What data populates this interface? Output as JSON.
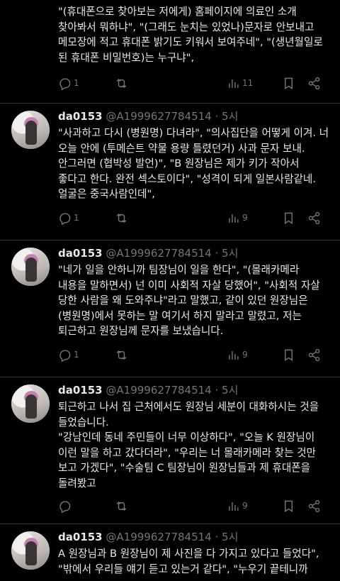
{
  "posts": [
    {
      "text": "\"(휴대폰으로 찾아보는 저에게) 홈페이지에 의료인 소개\n찾아봐서 뭐하냐\", \"(그래도 눈치는 있었나)문자로 안보내고\n메모장에 적고 휴대폰 밝기도 키워서 보여주네\", \"(생년월일로\n된 휴대폰 비밀번호)는 누구냐\",",
      "replies": "1",
      "retweets": "",
      "views": "11"
    },
    {
      "name": "da0153",
      "handle": "@A1999627784514",
      "time": "· 5시",
      "text": "\"사과하고 다시 (병원명) 다녀라\", \"의사집단을 어떻게 이겨. 너\n오늘 안에 (투메슨트 약물 용량 틀렸던거) 사과 문자 보내.\n안그러면 (협박성 발언)\", \"B 원장님은 제가 키가 작아서\n좋다고 한다. 완전 섹스토이다\", \"성격이 되게 일본사람같네.\n얼굴은 중국사람인데\",",
      "replies": "1",
      "retweets": "",
      "views": "9"
    },
    {
      "name": "da0153",
      "handle": "@A1999627784514",
      "time": "· 5시",
      "text": "\"네가 일을 안하니까 팀장님이 일을 한다\", \"(몰래카메라\n내용을 말하면서) 넌 이미 사회적 자살 당했어\", \"사회적 자살\n당한 사람을 왜 도와주냐\"라고 말했고, 같이 있던 원장님은\n(병원명)에서 못하는 말 여기서 하지 말라고 말렸고, 저는\n퇴근하고 원장님께 문자를 보냈습니다.",
      "replies": "1",
      "retweets": "",
      "views": "9"
    },
    {
      "name": "da0153",
      "handle": "@A1999627784514",
      "time": "· 5시",
      "text": "퇴근하고 나서 집 근처에서도 원장님 세분이 대화하시는 것을\n들었습니다.\n\"강남인데 동네 주민들이 너무 이상하다\", \"오늘 K 원장님이\n이런 말을 하고 갔다더라\", \"우리는 너 몰래카메라 찾는 것만\n보고 가겠다\", \"수술팀 C 팀장님이 원장님들과 제 휴대폰을\n돌려봤고",
      "replies": "",
      "retweets": "",
      "views": "9"
    },
    {
      "name": "da0153",
      "handle": "@A1999627784514",
      "time": "· 5시",
      "text": "A 원장님과 B 원장님이 제 사진을 다 가지고 있다고 들었다\",\n\"밖에서 우리들 얘기 듣고 있는거 같다\", \"누우기 끝테니까"
    }
  ],
  "icons": [
    "reply-icon",
    "retweet-icon",
    "views-icon",
    "bookmark-icon",
    "share-icon"
  ]
}
